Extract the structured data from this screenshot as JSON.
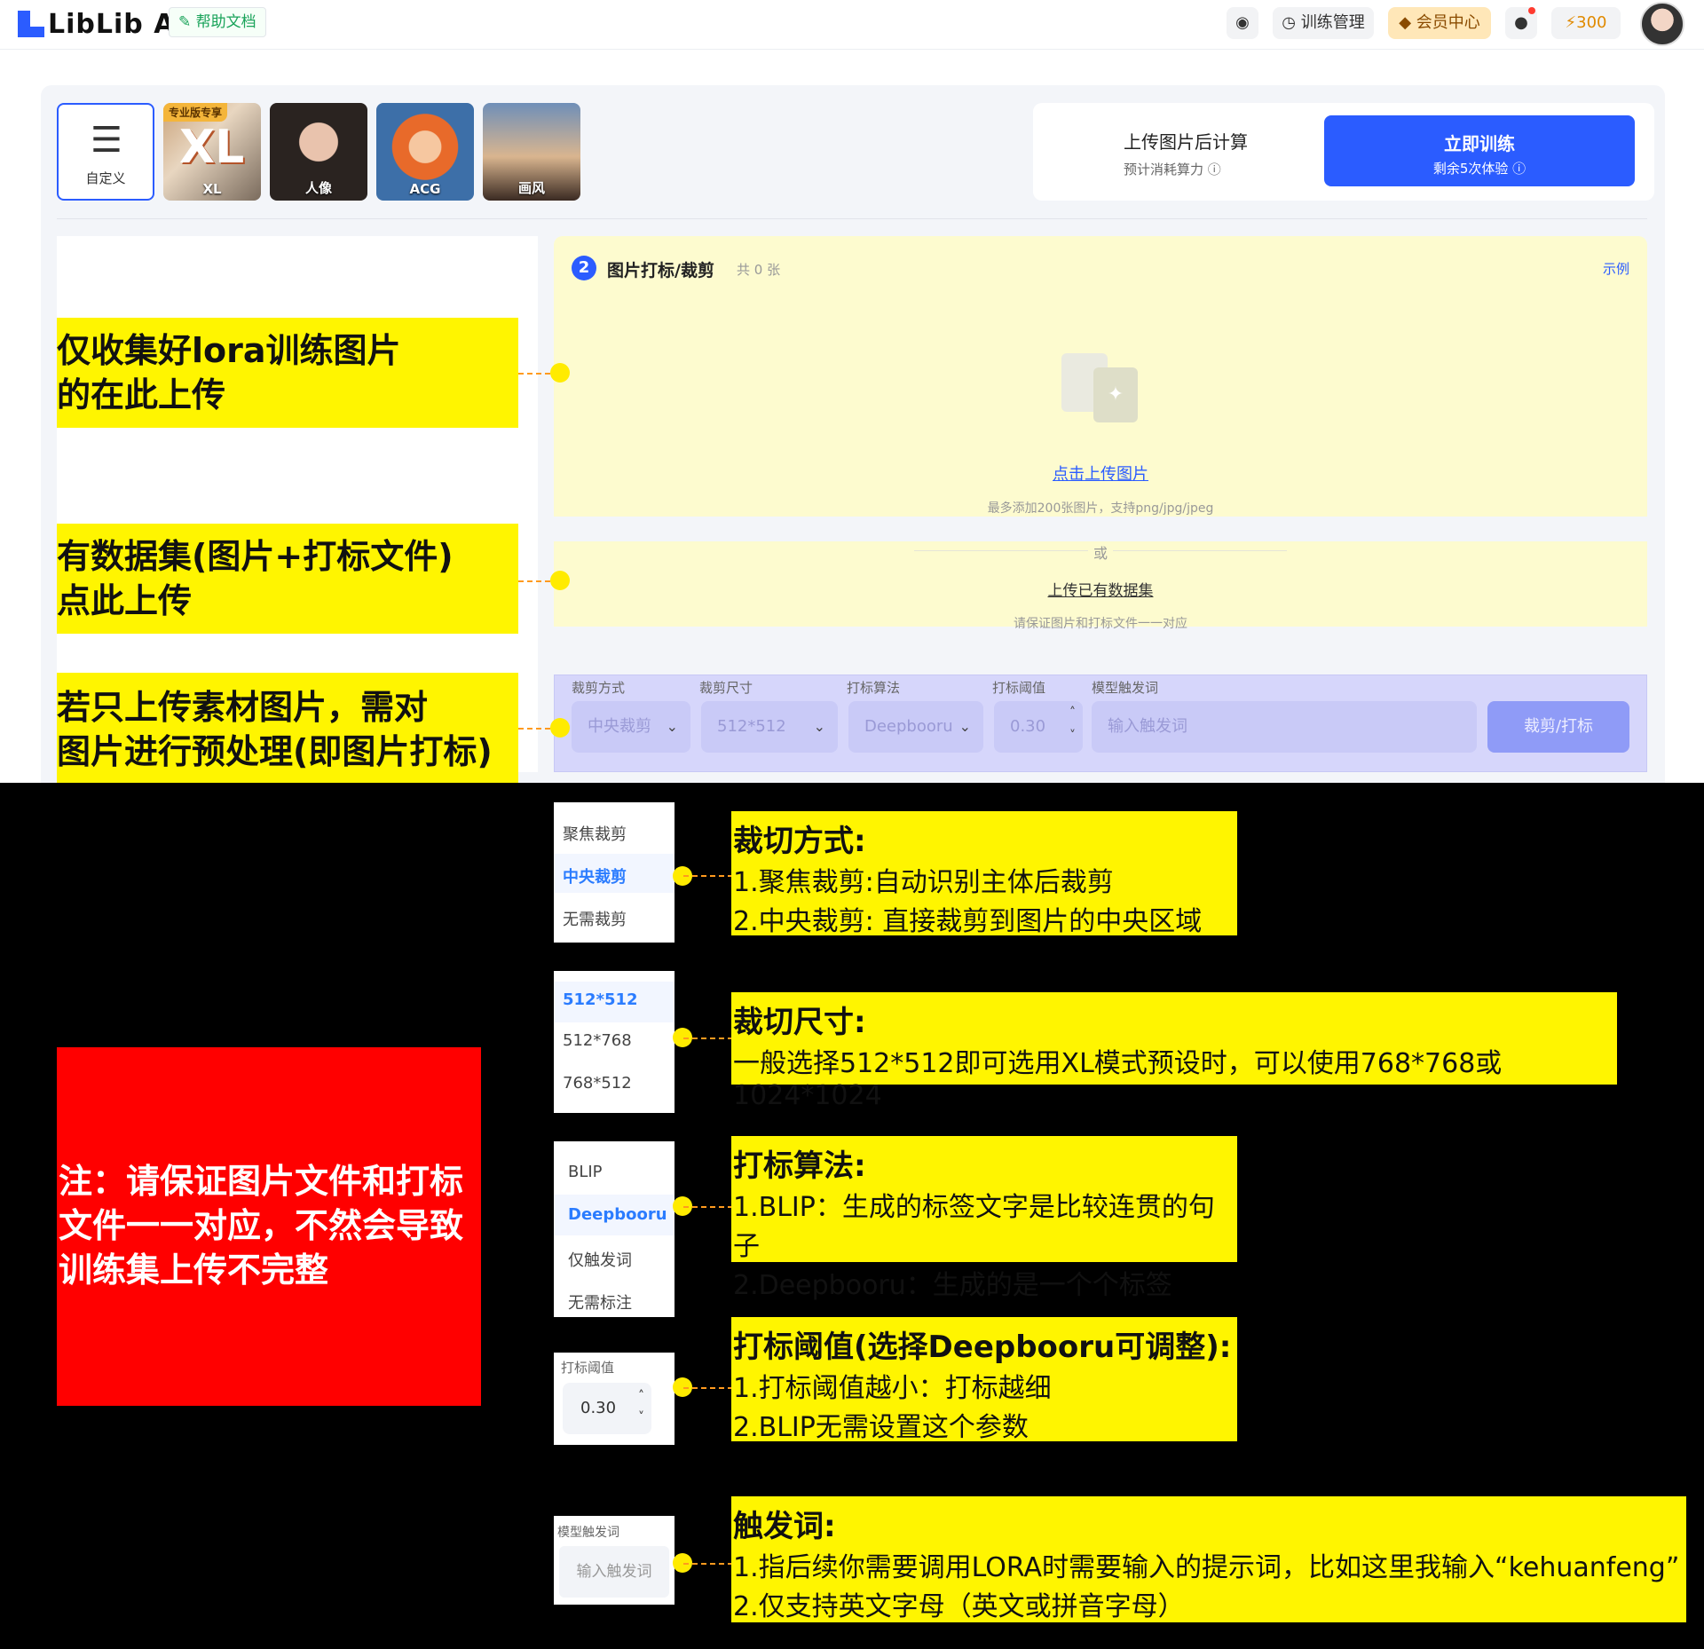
{
  "header": {
    "logo": "LibLib AI",
    "help_label": "帮助文档",
    "train_mgmt": "训练管理",
    "member_center": "会员中心",
    "points": "300"
  },
  "presets": [
    {
      "label": "自定义"
    },
    {
      "label": "XL",
      "badge": "专业版专享"
    },
    {
      "label": "人像"
    },
    {
      "label": "ACG"
    },
    {
      "label": "画风"
    }
  ],
  "cost": {
    "title": "上传图片后计算",
    "sub": "预计消耗算力",
    "train_label": "立即训练",
    "train_sub": "剩余5次体验"
  },
  "step": {
    "number": "2",
    "title": "图片打标/裁剪",
    "count": "共 0 张",
    "example": "示例",
    "upload_link": "点击上传图片",
    "upload_hint": "最多添加200张图片，支持png/jpg/jpeg",
    "or": "或",
    "dataset_link": "上传已有数据集",
    "dataset_hint": "请保证图片和打标文件一一对应"
  },
  "options": {
    "crop_mode_label": "裁剪方式",
    "crop_mode_value": "中央裁剪",
    "crop_size_label": "裁剪尺寸",
    "crop_size_value": "512*512",
    "tag_algo_label": "打标算法",
    "tag_algo_value": "Deepbooru",
    "threshold_label": "打标阈值",
    "threshold_value": "0.30",
    "trigger_label": "模型触发词",
    "trigger_placeholder": "输入触发词",
    "action_label": "裁剪/打标"
  },
  "annotations": {
    "a1": [
      "仅收集好lora训练图片",
      "的在此上传"
    ],
    "a2": [
      "有数据集(图片+打标文件)",
      "点此上传"
    ],
    "a3": [
      "若只上传素材图片，需对",
      "图片进行预处理(即图片打标)"
    ],
    "note": [
      "注：请保证图片文件和打标",
      "文件一一对应，不然会导致",
      "训练集上传不完整"
    ]
  },
  "menus": {
    "crop_mode": [
      "聚焦裁剪",
      "中央裁剪",
      "无需裁剪"
    ],
    "crop_size": [
      "512*512",
      "512*768",
      "768*512"
    ],
    "tag_algo": [
      "BLIP",
      "Deepbooru",
      "仅触发词",
      "无需标注"
    ],
    "threshold_label": "打标阈值",
    "threshold_value": "0.30",
    "trigger_label": "模型触发词",
    "trigger_placeholder": "输入触发词"
  },
  "callouts": {
    "c1": {
      "title": "裁切方式:",
      "lines": [
        "1.聚焦裁剪:自动识别主体后裁剪",
        "2.中央裁剪: 直接裁剪到图片的中央区域"
      ]
    },
    "c2": {
      "title": "裁切尺寸:",
      "lines": [
        "一般选择512*512即可选用XL模式预设时，可以使用768*768或1024*1024"
      ]
    },
    "c3": {
      "title": "打标算法:",
      "lines": [
        "1.BLIP：生成的标签文字是比较连贯的句子",
        "2.Deepbooru：生成的是一个个标签"
      ]
    },
    "c4": {
      "title": "打标阈值(选择Deepbooru可调整):",
      "lines": [
        "1.打标阈值越小：打标越细",
        "2.BLIP无需设置这个参数"
      ]
    },
    "c5": {
      "title": "触发词:",
      "lines": [
        "1.指后续你需要调用LORA时需要输入的提示词，比如这里我输入“kehuanfeng”",
        "2.仅支持英文字母（英文或拼音字母）"
      ]
    }
  }
}
